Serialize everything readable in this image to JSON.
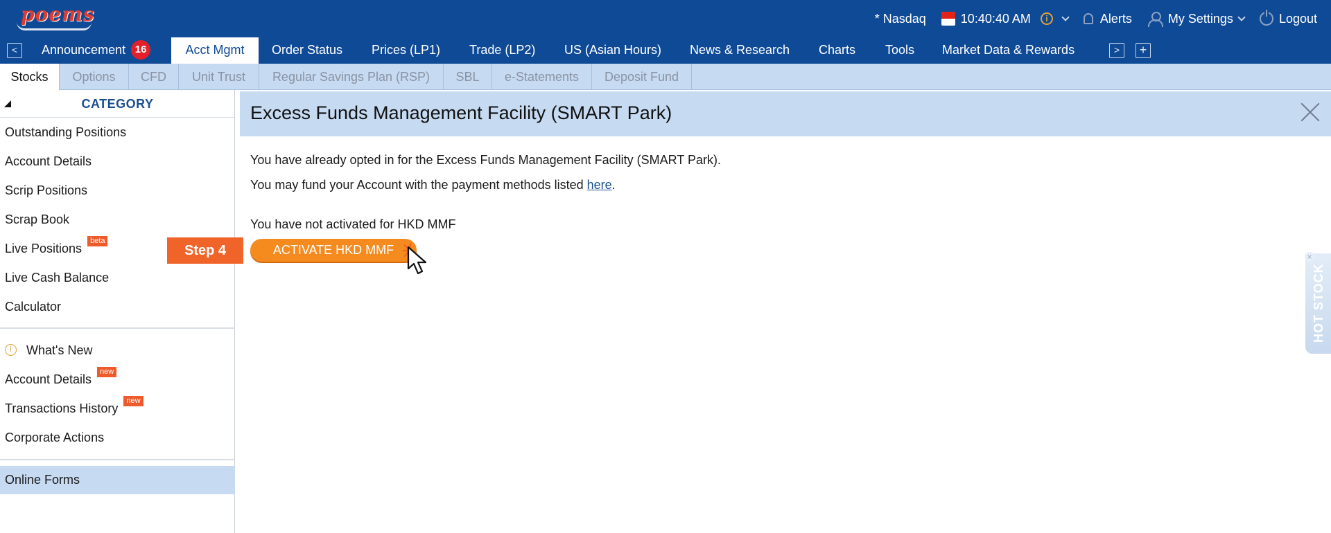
{
  "brand": {
    "logo_text": "poems"
  },
  "topbar": {
    "market": "* Nasdaq",
    "time": "10:40:40 AM",
    "alerts_label": "Alerts",
    "settings_label": "My Settings",
    "logout_label": "Logout"
  },
  "mainnav": {
    "tabs": [
      {
        "label": "Announcement",
        "badge": "16"
      },
      {
        "label": "Acct Mgmt"
      },
      {
        "label": "Order Status"
      },
      {
        "label": "Prices (LP1)"
      },
      {
        "label": "Trade (LP2)"
      },
      {
        "label": "US (Asian Hours)"
      },
      {
        "label": "News & Research"
      },
      {
        "label": "Charts"
      },
      {
        "label": "Tools"
      },
      {
        "label": "Market Data & Rewards"
      }
    ],
    "active_tab": "Acct Mgmt"
  },
  "subnav": {
    "tabs": [
      "Stocks",
      "Options",
      "CFD",
      "Unit Trust",
      "Regular Savings Plan (RSP)",
      "SBL",
      "e-Statements",
      "Deposit Fund"
    ],
    "active_tab": "Stocks"
  },
  "sidebar": {
    "title": "CATEGORY",
    "items": [
      {
        "label": "Outstanding Positions"
      },
      {
        "label": "Account Details"
      },
      {
        "label": "Scrip Positions"
      },
      {
        "label": "Scrap Book"
      },
      {
        "label": "Live Positions",
        "tag": "beta"
      },
      {
        "label": "Live Cash Balance"
      },
      {
        "label": "Calculator"
      }
    ],
    "items2": [
      {
        "label": "What's New"
      },
      {
        "label": "Account Details",
        "tag": "new"
      },
      {
        "label": "Transactions History",
        "tag": "new"
      },
      {
        "label": "Corporate Actions"
      }
    ],
    "items3": [
      {
        "label": "Online Forms"
      }
    ],
    "active_item": "Online Forms"
  },
  "panel": {
    "title": "Excess Funds Management Facility (SMART Park)",
    "line1": "You have already opted in for the Excess Funds Management Facility (SMART Park).",
    "line2_prefix": "You may fund your Account with the payment methods listed ",
    "line2_link": "here",
    "line2_suffix": ".",
    "line3": "You have not activated for HKD MMF",
    "activate_button": "ACTIVATE HKD MMF"
  },
  "annotation": {
    "step_label": "Step 4"
  },
  "hot_stock": {
    "label": "HOT STOCK"
  },
  "colors": {
    "header_blue": "#0f4a96",
    "light_blue": "#c6daf2",
    "button_orange": "#f58a1f",
    "step_orange": "#f0642a",
    "badge_red": "#e3202a"
  }
}
